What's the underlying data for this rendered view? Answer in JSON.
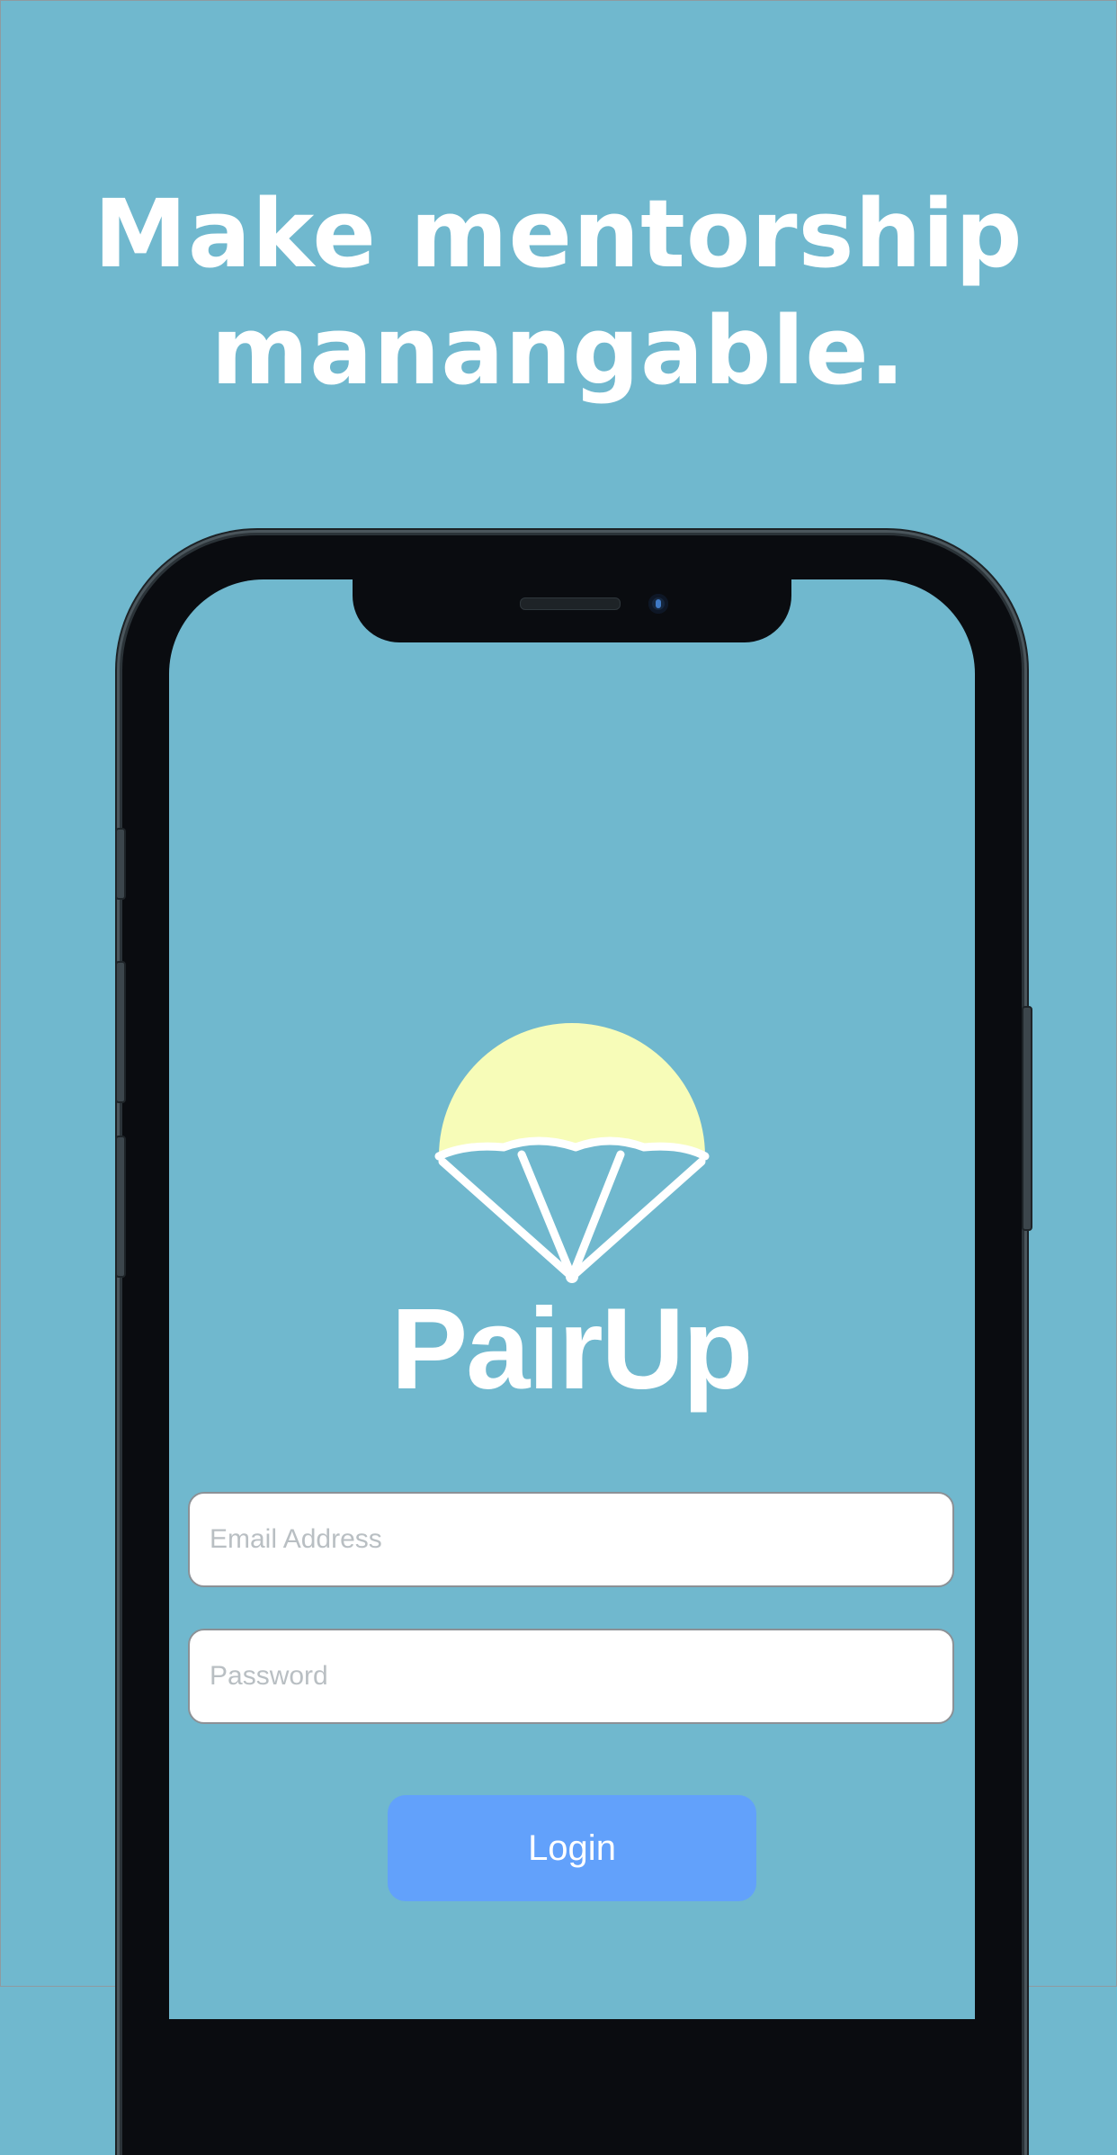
{
  "headline": {
    "line1": "Make mentorship",
    "line2": "manangable."
  },
  "app": {
    "name": "PairUp",
    "logo_icon": "parachute-icon"
  },
  "form": {
    "email_placeholder": "Email Address",
    "password_placeholder": "Password",
    "login_label": "Login"
  },
  "colors": {
    "background": "#70b8ce",
    "canopy": "#f7fcb8",
    "button": "#62a1fb",
    "text": "#ffffff"
  }
}
